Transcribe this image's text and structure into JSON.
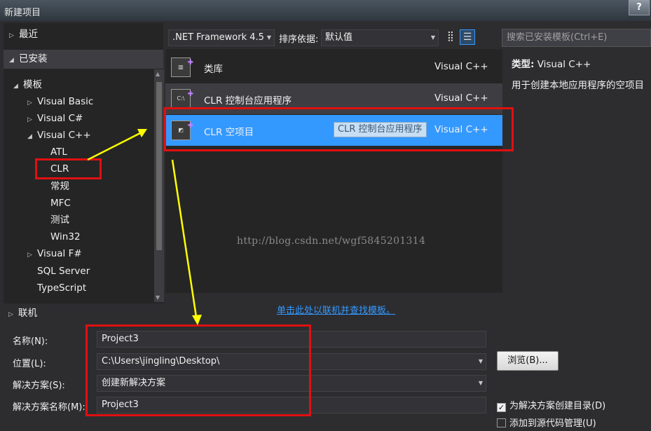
{
  "window": {
    "title": "新建项目",
    "help": "?"
  },
  "tree": {
    "recent": "最近",
    "installed": "已安装",
    "templates": "模板",
    "items": [
      "Visual Basic",
      "Visual C#",
      "Visual C++",
      "ATL",
      "CLR",
      "常规",
      "MFC",
      "测试",
      "Win32",
      "Visual F#",
      "SQL Server",
      "TypeScript"
    ],
    "online": "联机"
  },
  "toolbar": {
    "framework": ".NET Framework 4.5",
    "sort_label": "排序依据:",
    "sort_value": "默认值",
    "search_placeholder": "搜索已安装模板(Ctrl+E)"
  },
  "templates": [
    {
      "name": "类库",
      "lang": "Visual C++"
    },
    {
      "name": "CLR 控制台应用程序",
      "lang": "Visual C++"
    },
    {
      "name": "CLR 空项目",
      "lang": "Visual C++"
    }
  ],
  "tooltip": "CLR 控制台应用程序",
  "online_link": "单击此处以联机并查找模板。",
  "watermark": "http://blog.csdn.net/wgf5845201314",
  "details": {
    "type_label": "类型:",
    "type_value": "Visual C++",
    "description": "用于创建本地应用程序的空项目"
  },
  "form": {
    "name_label": "名称(N):",
    "name_value": "Project3",
    "location_label": "位置(L):",
    "location_value": "C:\\Users\\jingling\\Desktop\\",
    "solution_label": "解决方案(S):",
    "solution_value": "创建新解决方案",
    "solution_name_label": "解决方案名称(M):",
    "solution_name_value": "Project3",
    "browse_label": "浏览(B)...",
    "create_dir_label": "为解决方案创建目录(D)",
    "create_dir_checked": true,
    "add_source_label": "添加到源代码管理(U)",
    "add_source_checked": false
  },
  "colors": {
    "annotation_red": "#e01010",
    "annotation_yellow": "#ffff00",
    "selection_blue": "#3399ff"
  }
}
